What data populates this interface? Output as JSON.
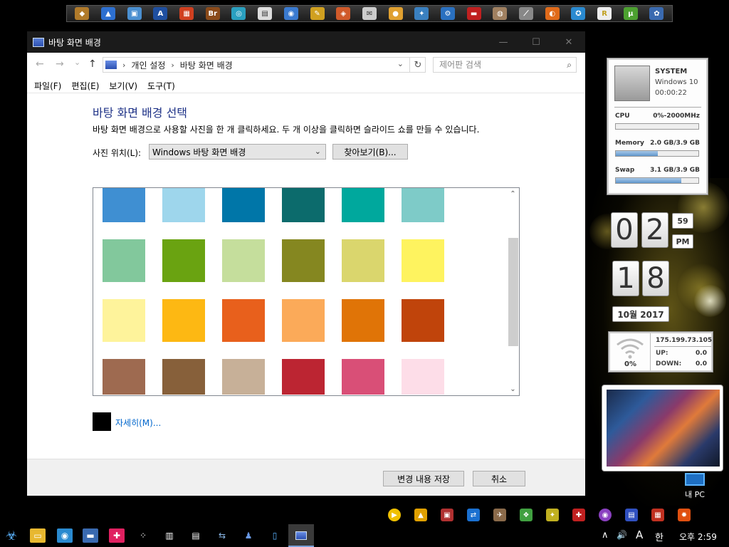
{
  "window": {
    "title": "바탕 화면 배경",
    "minimize_glyph": "—",
    "maximize_glyph": "☐",
    "close_glyph": "✕"
  },
  "nav": {
    "back_glyph": "←",
    "forward_glyph": "→",
    "recent_glyph": "⌄",
    "up_glyph": "↑",
    "breadcrumb": [
      "개인 설정",
      "바탕 화면 배경"
    ],
    "breadcrumb_sep": "›",
    "refresh_glyph": "↻",
    "search_placeholder": "제어판 검색",
    "search_glyph": "⌕"
  },
  "menu": [
    "파일(F)",
    "편집(E)",
    "보기(V)",
    "도구(T)"
  ],
  "content": {
    "heading": "바탕 화면 배경 선택",
    "description": "바탕 화면 배경으로 사용할 사진을 한 개 클릭하세요. 두 개 이상을 클릭하면 슬라이드 쇼를 만들 수 있습니다.",
    "location_label": "사진 위치(L):",
    "location_value": "Windows 바탕 화면 배경",
    "browse_label": "찾아보기(B)...",
    "detail_link": "자세히(M)...",
    "detail_color": "#000000"
  },
  "swatch_rows": [
    [
      "#3f8fd2",
      "#9ed6ec",
      "#0076a8",
      "#0c6b6c",
      "#00a89d",
      "#7ecbc8"
    ],
    [
      "#82c89c",
      "#6aa311",
      "#c5de9c",
      "#858720",
      "#dad66d",
      "#fef35f"
    ],
    [
      "#fef39b",
      "#fdb813",
      "#e8601c",
      "#fbaa59",
      "#e07407",
      "#c0440b"
    ],
    [
      "#9e6a50",
      "#87603a",
      "#c7b098",
      "#bc2532",
      "#d94f77",
      "#fddde8"
    ]
  ],
  "footer": {
    "save_label": "변경 내용 저장",
    "cancel_label": "취소"
  },
  "sysmon": {
    "title": "SYSTEM",
    "os": "Windows 10",
    "uptime": "00:00:22",
    "cpu_label": "CPU",
    "cpu_value": "0%-2000MHz",
    "cpu_pct": 0.0,
    "mem_label": "Memory",
    "mem_value": "2.0 GB/3.9 GB",
    "mem_pct": 0.51,
    "swap_label": "Swap",
    "swap_value": "3.1 GB/3.9 GB",
    "swap_pct": 0.79
  },
  "clock_gadget": {
    "hour_tens": "0",
    "hour_ones": "2",
    "minutes": "59",
    "ampm": "PM",
    "day_tens": "1",
    "day_ones": "8",
    "month_year": "10월 2017"
  },
  "network": {
    "signal": "0%",
    "ip": "175.199.73.105",
    "up_label": "UP:",
    "up_value": "0.0",
    "down_label": "DOWN:",
    "down_value": "0.0"
  },
  "desktop": {
    "my_pc_label": "내 PC"
  },
  "taskbar": {
    "clock": "오후 2:59",
    "tray_up_glyph": "∧",
    "volume_glyph": "🔊",
    "input_glyph": "A",
    "ime_glyph": "한"
  }
}
